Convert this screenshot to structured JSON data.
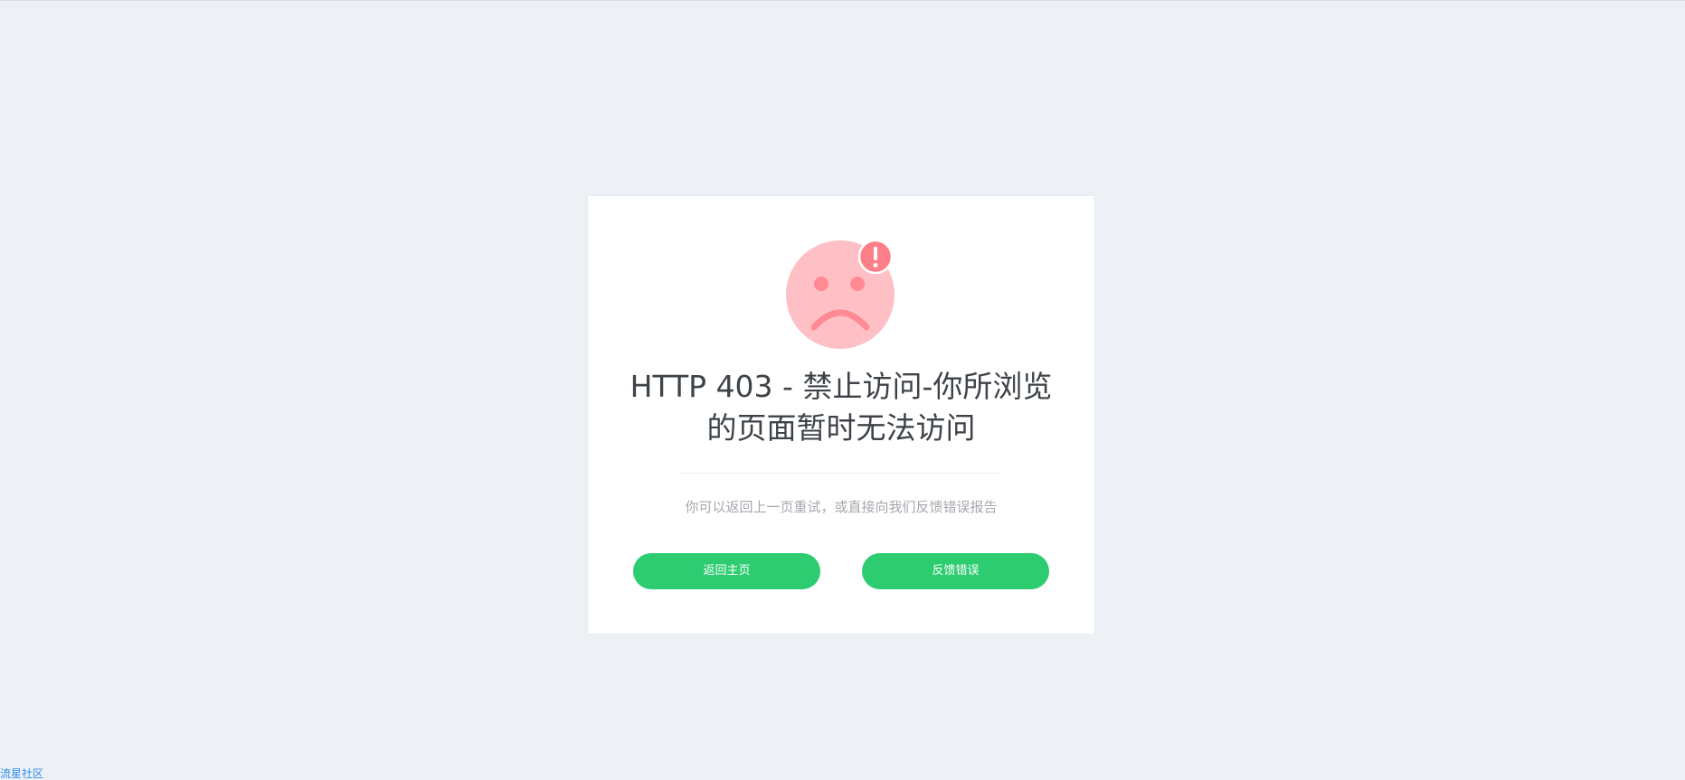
{
  "error": {
    "title": "HTTP 403 - 禁止访问-你所浏览的页面暂时无法访问",
    "subtitle": "你可以返回上一页重试，或直接向我们反馈错误报告",
    "icon": "sad-face-icon",
    "alert_icon": "exclamation-icon"
  },
  "buttons": {
    "home_label": "返回主页",
    "feedback_label": "反馈错误"
  },
  "footer": {
    "link_text": "流星社区"
  },
  "colors": {
    "background": "#edf1f5",
    "card": "#ffffff",
    "accent": "#2ecc71",
    "face": "#ffc0c5",
    "face_features": "#ff8a93",
    "link": "#2d8cf0"
  }
}
